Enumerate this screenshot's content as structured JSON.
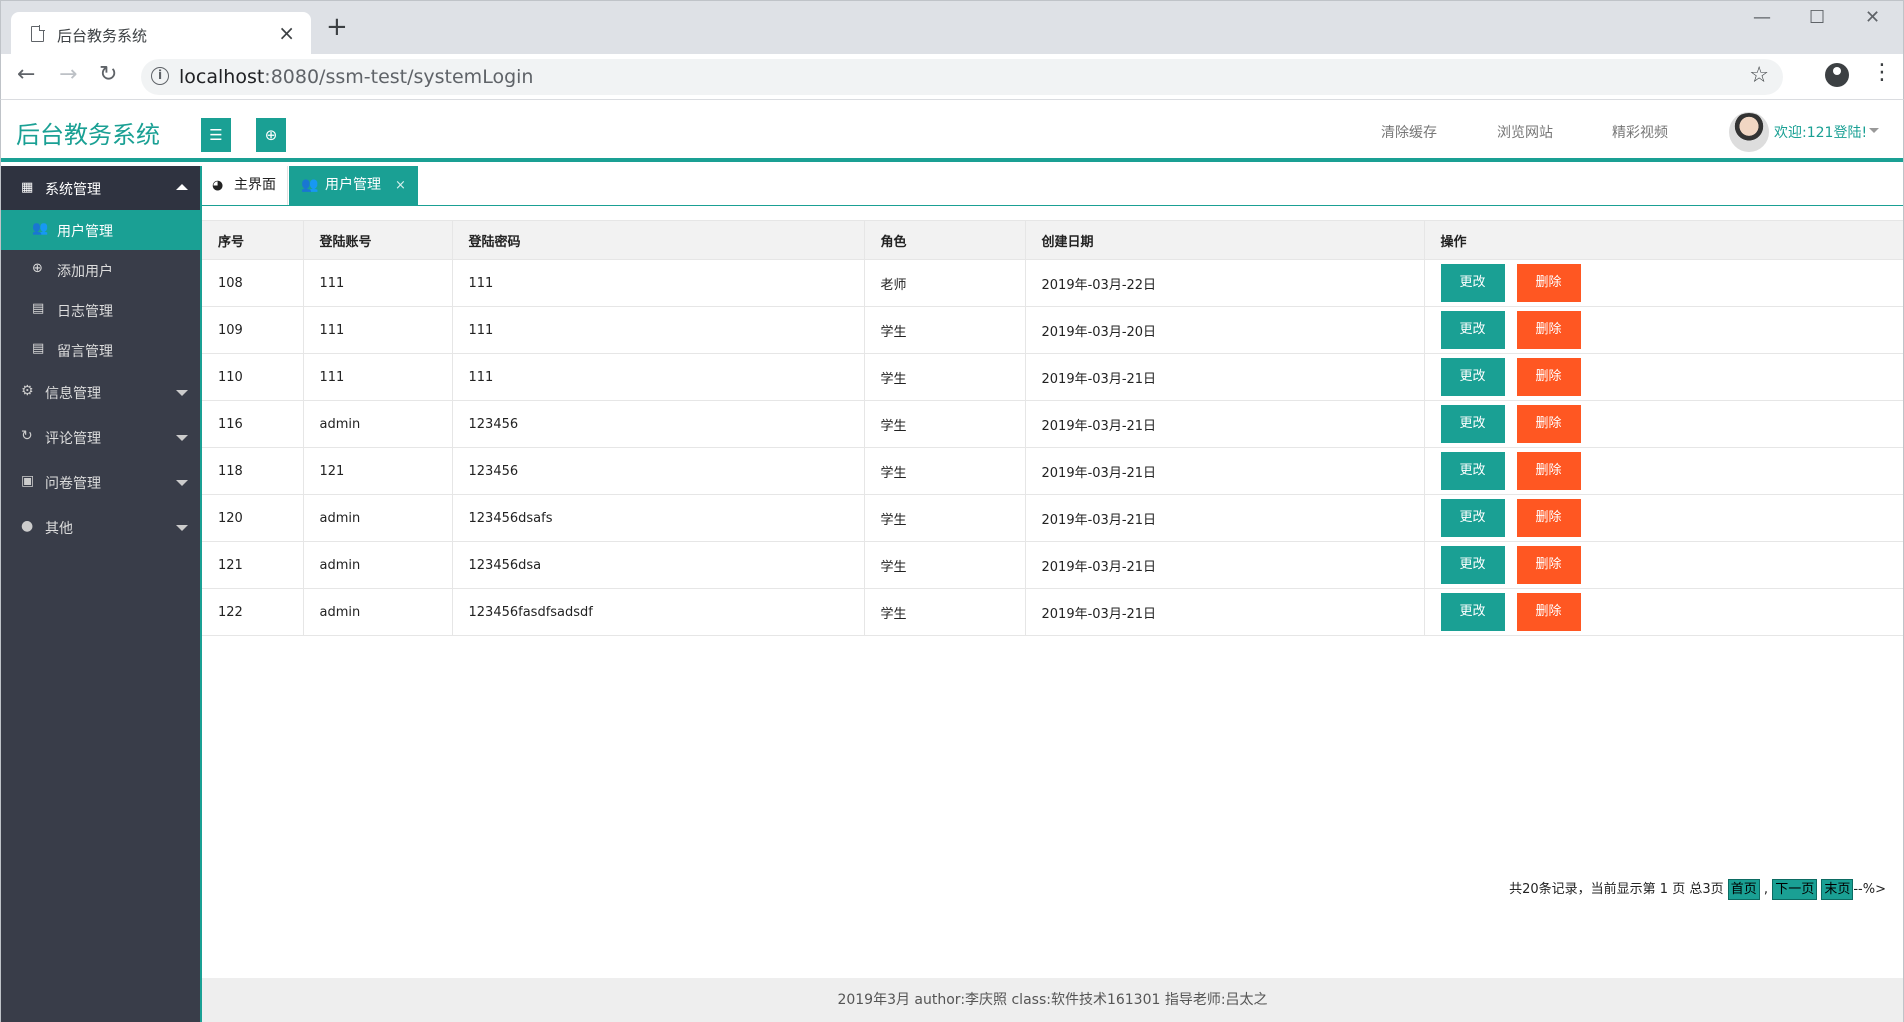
{
  "browser": {
    "tab_title": "后台教务系统",
    "tab_close": "×",
    "new_tab": "+",
    "url_host": "localhost",
    "url_path": ":8080/ssm-test/systemLogin",
    "minimize": "—",
    "maximize": "☐",
    "close": "✕"
  },
  "header": {
    "logo": "后台教务系统",
    "links": [
      "清除缓存",
      "浏览网站",
      "精彩视频"
    ],
    "welcome": "欢迎:121登陆!"
  },
  "sidebar": {
    "system_group": "系统管理",
    "sub_items": [
      "用户管理",
      "添加用户",
      "日志管理",
      "留言管理"
    ],
    "top_items": [
      "信息管理",
      "评论管理",
      "问卷管理",
      "其他"
    ]
  },
  "tabs": {
    "home": "主界面",
    "active": "用户管理",
    "close": "×"
  },
  "table": {
    "columns": [
      "序号",
      "登陆账号",
      "登陆密码",
      "角色",
      "创建日期",
      "操作"
    ],
    "rows": [
      {
        "id": "108",
        "account": "111",
        "password": "111",
        "role": "老师",
        "date": "2019年-03月-22日"
      },
      {
        "id": "109",
        "account": "111",
        "password": "111",
        "role": "学生",
        "date": "2019年-03月-20日"
      },
      {
        "id": "110",
        "account": "111",
        "password": "111",
        "role": "学生",
        "date": "2019年-03月-21日"
      },
      {
        "id": "116",
        "account": "admin",
        "password": "123456",
        "role": "学生",
        "date": "2019年-03月-21日"
      },
      {
        "id": "118",
        "account": "121",
        "password": "123456",
        "role": "学生",
        "date": "2019年-03月-21日"
      },
      {
        "id": "120",
        "account": "admin",
        "password": "123456dsafs",
        "role": "学生",
        "date": "2019年-03月-21日"
      },
      {
        "id": "121",
        "account": "admin",
        "password": "123456dsa",
        "role": "学生",
        "date": "2019年-03月-21日"
      },
      {
        "id": "122",
        "account": "admin",
        "password": "123456fasdfsadsdf",
        "role": "学生",
        "date": "2019年-03月-21日"
      }
    ],
    "edit_label": "更改",
    "delete_label": "删除"
  },
  "pager": {
    "summary": "共20条记录，当前显示第 1 页 总3页",
    "first": "首页",
    "sep": ",",
    "next": "下一页",
    "last": "末页",
    "tail": "--%>"
  },
  "footer": {
    "text": "2019年3月 author:李庆照  class:软件技术161301     指导老师:吕太之"
  },
  "colors": {
    "accent": "#1aa094",
    "danger": "#ff5722",
    "sidebar": "#393d49"
  }
}
